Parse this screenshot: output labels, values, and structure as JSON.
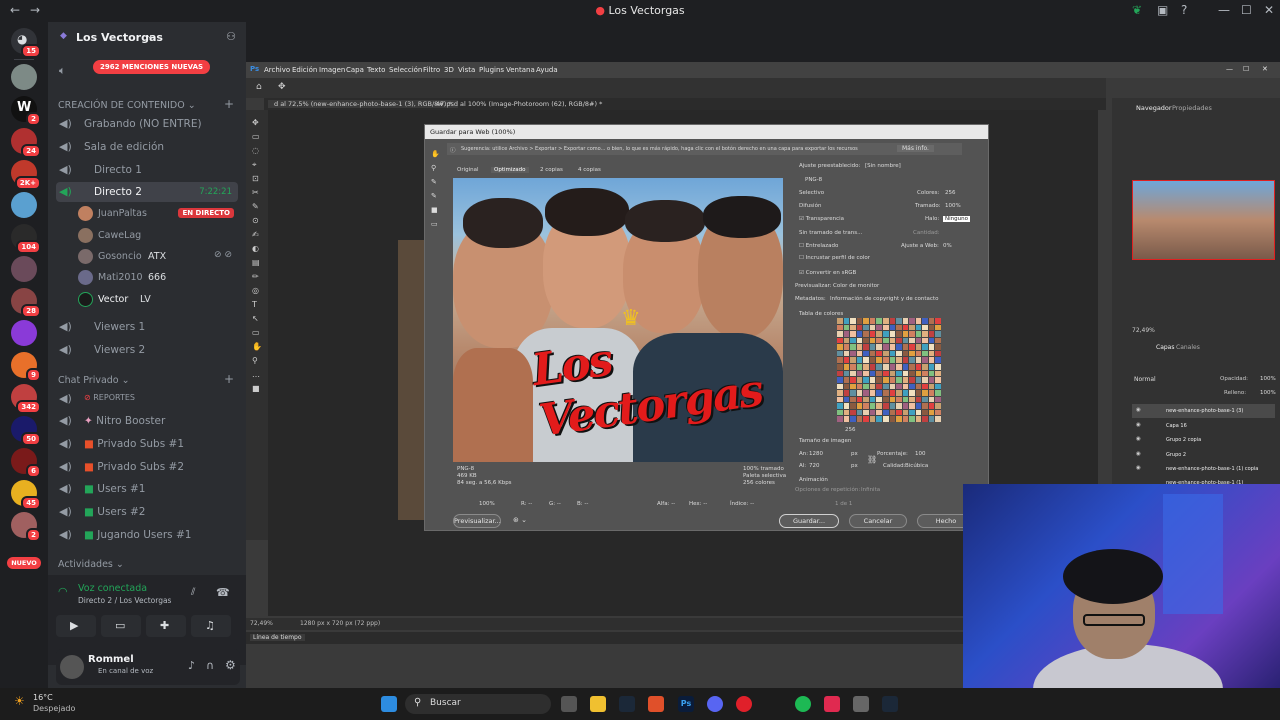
{
  "window": {
    "title": "Los Vectorgas"
  },
  "server": {
    "name": "Los Vectorgas",
    "mentions": "2962 MENCIONES NUEVAS"
  },
  "rail": {
    "badges": [
      "15",
      "2",
      "24",
      "2K+",
      "104",
      "28",
      "9",
      "342",
      "50",
      "6",
      "45",
      "2"
    ],
    "nuevo": "NUEVO"
  },
  "categories": {
    "content": "CREACIÓN DE CONTENIDO",
    "private": "Chat Privado",
    "activities": "Actividades"
  },
  "channels": {
    "grabando": "Grabando (NO ENTRE)",
    "sala": "Sala de edición",
    "directo1": "Directo 1",
    "directo2": "Directo 2",
    "directo2_timer": "7:22:21",
    "viewers1": "Viewers 1",
    "viewers2": "Viewers 2",
    "reportes": "REPORTES",
    "nitro": "Nitro Booster",
    "privado1": "Privado Subs #1",
    "privado2": "Privado Subs #2",
    "users1": "Users #1",
    "users2": "Users #2",
    "jugando": "Jugando Users #1"
  },
  "voice_users": [
    {
      "name": "JuanPaltas",
      "tag": "EN DIRECTO"
    },
    {
      "name": "CaweLag",
      "tag": ""
    },
    {
      "name": "Gosoncio",
      "tag": "ATX"
    },
    {
      "name": "Mati2010",
      "tag": "666"
    },
    {
      "name": "Vector",
      "tag": "LV"
    }
  ],
  "voice": {
    "status": "Voz conectada",
    "location": "Directo 2 / Los Vectorgas"
  },
  "user": {
    "name": "Rommel",
    "status": "En canal de voz"
  },
  "taskbar": {
    "weather_temp": "16°C",
    "weather_desc": "Despejado",
    "search": "Buscar"
  },
  "photoshop": {
    "menu": [
      "Archivo",
      "Edición",
      "Imagen",
      "Capa",
      "Texto",
      "Selección",
      "Filtro",
      "3D",
      "Vista",
      "Plugins",
      "Ventana",
      "Ayuda"
    ],
    "tab1": "d al 72,5% (new-enhance-photo-base-1 (3), RGB/8#) *",
    "tab2": "47.psd al 100% (Image-Photoroom (62), RGB/8#) *",
    "status": "72,49%",
    "status_size": "1280 px x 720 px (72 ppp)",
    "timeline": "Línea de tiempo",
    "panel_nav": "Navegador",
    "panel_props": "Propiedades",
    "zoom": "72,49%",
    "layers_tab": "Capas",
    "channels_tab": "Canales",
    "layers": [
      "new-enhance-photo-base-1 (3)",
      "Capa 16",
      "Grupo 2 copia",
      "Grupo 2",
      "new-enhance-photo-base-1 (1) copia",
      "new-enhance-photo-base-1 (1)"
    ],
    "blend": "Normal",
    "opacity_label": "Opacidad:",
    "opacity": "100%",
    "fill_label": "Relleno:",
    "fill": "100%"
  },
  "dialog": {
    "title": "Guardar para Web (100%)",
    "hint": "Sugerencia: utilice Archivo > Exportar > Exportar como... o bien, lo que es más rápido, haga clic con el botón derecho en una capa para exportar los recursos",
    "more_info": "Más info.",
    "tabs": [
      "Original",
      "Optimizado",
      "2 copias",
      "4 copias"
    ],
    "preset_label": "Ajuste preestablecido:",
    "preset": "[Sin nombre]",
    "format": "PNG-8",
    "reduction": "Selectivo",
    "colors_label": "Colores:",
    "colors": "256",
    "dither_algo": "Difusión",
    "dither_label": "Tramado:",
    "dither": "100%",
    "transparency": "Transparencia",
    "matte_label": "Halo:",
    "matte": "Ninguno",
    "trans_dither": "Sin tramado de trans...",
    "amount_label": "Cantidad:",
    "interlaced": "Entrelazado",
    "web_snap_label": "Ajuste a Web:",
    "web_snap": "0%",
    "embed_profile": "Incrustar perfil de color",
    "convert_srgb": "Convertir en sRGB",
    "preview_label": "Previsualizar:",
    "preview": "Color de monitor",
    "metadata_label": "Metadatos:",
    "metadata": "Información de copyright y de contacto",
    "color_table": "Tabla de colores",
    "color_count": "256",
    "image_size": "Tamaño de imagen",
    "w_label": "An:",
    "w": "1280",
    "h_label": "Al:",
    "h": "720",
    "px": "px",
    "percent_label": "Porcentaje:",
    "percent": "100",
    "quality_label": "Calidad:",
    "quality": "Bicúbica",
    "animation": "Animación",
    "loop": "Opciones de repetición:",
    "loop_val": "Infinita",
    "frame": "1 de 1",
    "info_left": [
      "PNG-8",
      "469 KB",
      "84 seg. a 56,6 Kbps"
    ],
    "info_right": [
      "100% tramado",
      "Paleta selectiva",
      "256 colores"
    ],
    "zoom": "100%",
    "channels": [
      "R: --",
      "G: --",
      "B: --",
      "Alfa: --",
      "Hex: --",
      "Índice: --"
    ],
    "preview_btn": "Previsualizar...",
    "save": "Guardar...",
    "cancel": "Cancelar",
    "done": "Hecho",
    "logo_text": "Los Vectorgas"
  },
  "colors": {
    "accent_red": "#f23f43",
    "online_green": "#23a559",
    "discord_bg": "#2b2d31"
  }
}
